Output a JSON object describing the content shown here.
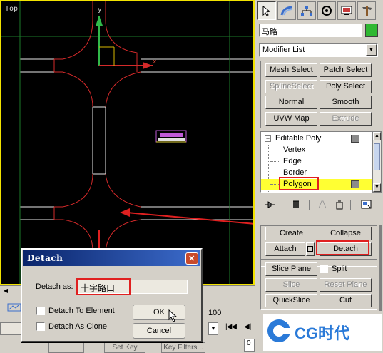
{
  "viewport": {
    "label": "Top",
    "axis_x": "x",
    "axis_y": "y"
  },
  "command_panel": {
    "object_name": "马路",
    "object_color": "#2fb832",
    "modifier_list": {
      "selected": "Modifier List"
    },
    "buttons": {
      "mesh_select": "Mesh Select",
      "patch_select": "Patch Select",
      "spline_select": "SplineSelect",
      "poly_select": "Poly Select",
      "normal": "Normal",
      "smooth": "Smooth",
      "uvw_map": "UVW Map",
      "extrude": "Extrude"
    },
    "stack": {
      "root": "Editable Poly",
      "items": [
        "Vertex",
        "Edge",
        "Border",
        "Polygon"
      ]
    },
    "edit_geometry": {
      "create": "Create",
      "collapse": "Collapse",
      "attach": "Attach",
      "detach": "Detach",
      "slice_plane": "Slice Plane",
      "split": "Split",
      "slice": "Slice",
      "reset_plane": "Reset Plane",
      "quickslice": "QuickSlice",
      "cut": "Cut"
    }
  },
  "dialog": {
    "title": "Detach",
    "detach_as_label": "Detach as:",
    "detach_as_value": "十字路口",
    "detach_to_element": "Detach To Element",
    "detach_as_clone": "Detach As Clone",
    "ok": "OK",
    "cancel": "Cancel"
  },
  "timeline": {
    "frame_marker": "100",
    "frame_value": "0",
    "set_key": "Set Key",
    "key_filters": "Key Filters..."
  },
  "watermark": "CG时代",
  "colors": {
    "selection_yellow": "#ffff33",
    "annotation_red": "#e02020",
    "title_blue": "#0a246a"
  }
}
